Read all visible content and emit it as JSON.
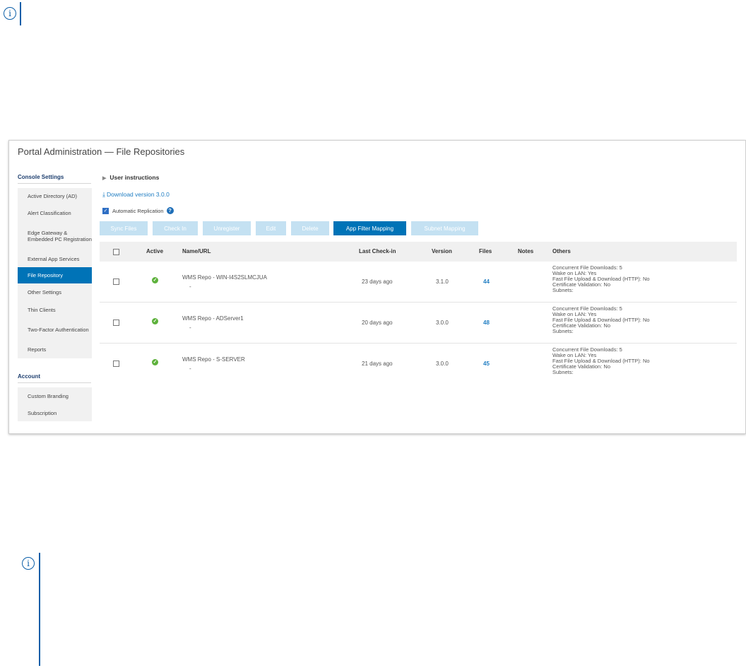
{
  "page": {
    "title": "Portal Administration — File Repositories"
  },
  "notes": {
    "icon_glyph": "i"
  },
  "sidebar": {
    "console_heading": "Console Settings",
    "console_items": [
      {
        "label": "Active Directory (AD)"
      },
      {
        "label": "Alert Classification"
      },
      {
        "label": "Edge Gateway & Embedded PC Registration"
      },
      {
        "label": "External App Services"
      },
      {
        "label": "File Repository",
        "active": true
      },
      {
        "label": "Other Settings"
      },
      {
        "label": "Thin Clients"
      },
      {
        "label": "Two-Factor Authentication"
      },
      {
        "label": "Reports"
      }
    ],
    "account_heading": "Account",
    "account_items": [
      {
        "label": "Custom Branding"
      },
      {
        "label": "Subscription"
      }
    ]
  },
  "main": {
    "user_instructions": "User instructions",
    "download_link": "Download version 3.0.0",
    "auto_replication_label": "Automatic Replication",
    "auto_replication_checked": true
  },
  "toolbar": {
    "sync_files": "Sync Files",
    "check_in": "Check In",
    "unregister": "Unregister",
    "edit": "Edit",
    "delete": "Delete",
    "app_filter_mapping": "App Filter Mapping",
    "subnet_mapping": "Subnet Mapping"
  },
  "table": {
    "headers": {
      "active": "Active",
      "name": "Name/URL",
      "last_checkin": "Last Check-in",
      "version": "Version",
      "files": "Files",
      "notes": "Notes",
      "others": "Others"
    },
    "rows": [
      {
        "name": "WMS Repo - WIN-I4S2SLMCJUA",
        "url": "-",
        "last_checkin": "23 days ago",
        "version": "3.1.0",
        "files": "44",
        "others": {
          "concurrent": "Concurrent File Downloads: 5",
          "wol": "Wake on LAN: Yes",
          "fast": "Fast File Upload & Download (HTTP): No",
          "cert": "Certificate Validation: No",
          "subnets": "Subnets:"
        }
      },
      {
        "name": "WMS Repo - ADServer1",
        "url": "-",
        "last_checkin": "20 days ago",
        "version": "3.0.0",
        "files": "48",
        "others": {
          "concurrent": "Concurrent File Downloads: 5",
          "wol": "Wake on LAN: Yes",
          "fast": "Fast File Upload & Download (HTTP): No",
          "cert": "Certificate Validation: No",
          "subnets": "Subnets:"
        }
      },
      {
        "name": "WMS Repo - S-SERVER",
        "url": "-",
        "last_checkin": "21 days ago",
        "version": "3.0.0",
        "files": "45",
        "others": {
          "concurrent": "Concurrent File Downloads: 5",
          "wol": "Wake on LAN: Yes",
          "fast": "Fast File Upload & Download (HTTP): No",
          "cert": "Certificate Validation: No",
          "subnets": "Subnets:"
        }
      }
    ]
  },
  "colors": {
    "accent": "#0073b7",
    "disabled_button": "#c4e1f2",
    "link": "#1f7dc2",
    "success": "#5db13b",
    "note": "#0b5ea8"
  }
}
